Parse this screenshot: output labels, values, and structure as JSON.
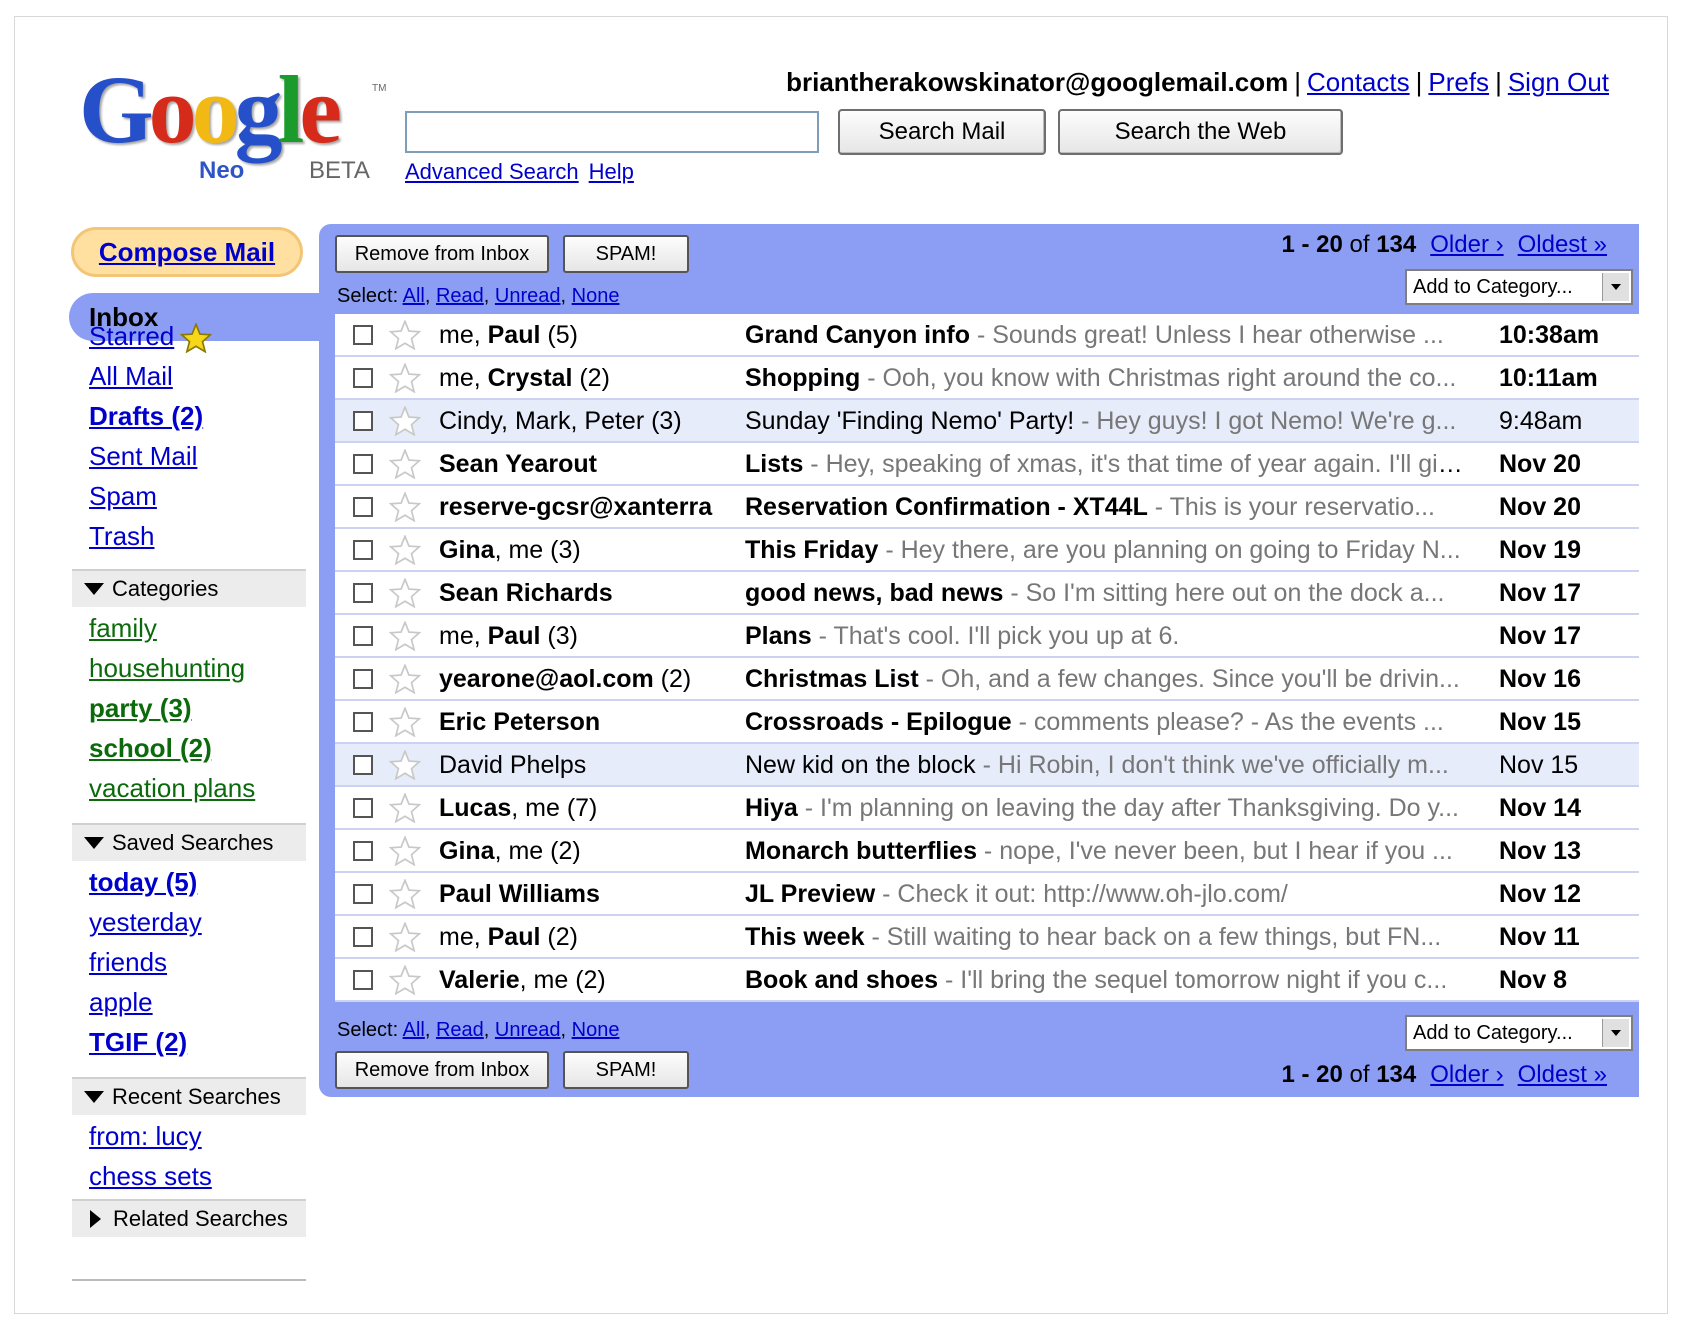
{
  "logo": {
    "word": [
      "G",
      "o",
      "o",
      "g",
      "l",
      "e"
    ],
    "colors": [
      "#2550c9",
      "#d62a1a",
      "#f2b813",
      "#2550c9",
      "#1a9b2b",
      "#d62a1a"
    ],
    "tm": "TM",
    "neo": "Neo",
    "beta": "BETA"
  },
  "header": {
    "user_email": "briantherakowskinator@googlemail.com",
    "separator": "|",
    "contacts": "Contacts",
    "prefs": "Prefs",
    "sign_out": "Sign Out",
    "search_value": "",
    "search_mail": "Search Mail",
    "search_web": "Search the Web",
    "advanced_search": "Advanced Search",
    "help": "Help"
  },
  "sidebar": {
    "compose": "Compose Mail",
    "inbox": "Inbox",
    "starred": "Starred",
    "all_mail": "All Mail",
    "drafts": "Drafts (2)",
    "sent": "Sent Mail",
    "spam": "Spam",
    "trash": "Trash",
    "categories_label": "Categories",
    "categories": [
      "family",
      "househunting",
      "party (3)",
      "school (2)",
      "vacation plans"
    ],
    "saved_label": "Saved Searches",
    "saved": [
      "today (5)",
      "yesterday",
      "friends",
      "apple",
      "TGIF (2)"
    ],
    "recent_label": "Recent Searches",
    "recent": [
      "from: lucy",
      "chess sets"
    ],
    "related_label": "Related Searches"
  },
  "toolbar": {
    "remove": "Remove from Inbox",
    "spam": "SPAM!",
    "select_label": "Select:",
    "select_all": "All",
    "select_read": "Read",
    "select_unread": "Unread",
    "select_none": "None",
    "comma": ",",
    "range": "1 - 20",
    "of": "of",
    "total": "134",
    "older": "Older ›",
    "oldest": "Oldest »",
    "add_category": "Add to Category..."
  },
  "messages": [
    {
      "from_pre": "me, ",
      "from_bold": "Paul",
      "from_post": " (5)",
      "subject": "Grand Canyon info",
      "snippet": " - Sounds great! Unless I hear otherwise ...",
      "date": "10:38am",
      "unread": true
    },
    {
      "from_pre": "me, ",
      "from_bold": "Crystal",
      "from_post": " (2)",
      "subject": "Shopping",
      "snippet": " - Ooh, you know with Christmas right around the co...",
      "date": "10:11am",
      "unread": true
    },
    {
      "from_pre": "Cindy, Mark, Peter",
      "from_bold": "",
      "from_post": " (3)",
      "subject": "Sunday 'Finding Nemo' Party!",
      "snippet": " - Hey guys! I got Nemo! We're g...",
      "date": "9:48am",
      "unread": false
    },
    {
      "from_pre": "",
      "from_bold": "Sean Yearout",
      "from_post": "",
      "subject": "Lists",
      "snippet": " - Hey, speaking of xmas, it's that time of year again. I'll giv...",
      "date": "Nov 20",
      "unread": true
    },
    {
      "from_pre": "",
      "from_bold": "reserve-gcsr@xanterra",
      "from_post": "",
      "subject": "Reservation Confirmation - XT44L",
      "snippet": " - This is your reservatio...",
      "date": "Nov 20",
      "unread": true
    },
    {
      "from_pre": "",
      "from_bold": "Gina",
      "from_post": ", me (3)",
      "subject": "This Friday",
      "snippet": " - Hey there, are you planning on going to Friday N...",
      "date": "Nov 19",
      "unread": true
    },
    {
      "from_pre": "",
      "from_bold": "Sean Richards",
      "from_post": "",
      "subject": "good news, bad news",
      "snippet": " - So I'm sitting here out on the dock a...",
      "date": "Nov 17",
      "unread": true
    },
    {
      "from_pre": "me, ",
      "from_bold": "Paul",
      "from_post": " (3)",
      "subject": "Plans",
      "snippet": " - That's cool. I'll pick you up at 6.",
      "date": "Nov 17",
      "unread": true
    },
    {
      "from_pre": "",
      "from_bold": "yearone@aol.com",
      "from_post": " (2)",
      "subject": "Christmas List",
      "snippet": " - Oh, and a few changes. Since you'll be drivin...",
      "date": "Nov 16",
      "unread": true
    },
    {
      "from_pre": "",
      "from_bold": "Eric Peterson",
      "from_post": "",
      "subject": "Crossroads - Epilogue",
      "snippet": " - comments please? - As the events ...",
      "date": "Nov 15",
      "unread": true
    },
    {
      "from_pre": "David Phelps",
      "from_bold": "",
      "from_post": "",
      "subject": "New kid on the block",
      "snippet": " - Hi Robin, I don't think we've officially m...",
      "date": "Nov 15",
      "unread": false
    },
    {
      "from_pre": "",
      "from_bold": "Lucas",
      "from_post": ", me (7)",
      "subject": "Hiya",
      "snippet": " - I'm planning on leaving the day after Thanksgiving. Do y...",
      "date": "Nov 14",
      "unread": true
    },
    {
      "from_pre": "",
      "from_bold": "Gina",
      "from_post": ", me (2)",
      "subject": "Monarch butterflies",
      "snippet": " - nope, I've never been, but I hear if you ...",
      "date": "Nov 13",
      "unread": true
    },
    {
      "from_pre": "",
      "from_bold": "Paul Williams",
      "from_post": "",
      "subject": "JL Preview",
      "snippet": " - Check it out: http://www.oh-jlo.com/",
      "date": "Nov 12",
      "unread": true
    },
    {
      "from_pre": "me, ",
      "from_bold": "Paul",
      "from_post": " (2)",
      "subject": "This week",
      "snippet": " - Still waiting to hear back on a few things, but FN...",
      "date": "Nov 11",
      "unread": true
    },
    {
      "from_pre": "",
      "from_bold": "Valerie",
      "from_post": ", me (2)",
      "subject": "Book and shoes",
      "snippet": " - I'll bring the sequel tomorrow night if you c...",
      "date": "Nov 8",
      "unread": true
    }
  ],
  "colors": {
    "panel": "#8c9ef4",
    "read_row": "#e7ecfa",
    "link": "#0000cc",
    "category_link": "#0c6a0c",
    "compose_bg": "#ffe0a0"
  }
}
